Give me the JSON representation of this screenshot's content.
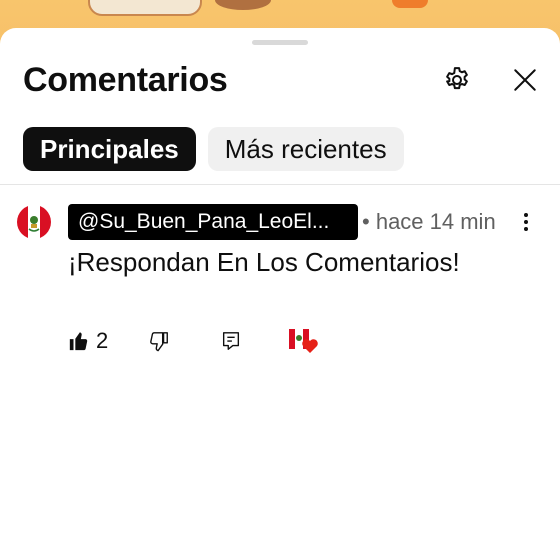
{
  "panel": {
    "title": "Comentarios"
  },
  "tabs": [
    {
      "label": "Principales",
      "selected": true
    },
    {
      "label": "Más recientes",
      "selected": false
    }
  ],
  "comments": [
    {
      "author": "@Su_Buen_Pana_LeoEl...",
      "separator": "•",
      "time": "hace 14 min",
      "text": "¡Respondan En Los Comentarios!",
      "likes": "2"
    }
  ],
  "icons": {
    "settings": "gear-icon",
    "close": "close-icon",
    "more": "more-vert-icon",
    "like": "thumb-up-icon",
    "dislike": "thumb-down-icon",
    "reply": "reply-icon",
    "heart": "creator-heart-icon"
  },
  "colors": {
    "accent_red": "#e62117",
    "text_primary": "#0f0f0f",
    "text_secondary": "#606060",
    "chip_active_bg": "#0f0f0f",
    "chip_inactive_bg": "#f0f0f0"
  }
}
